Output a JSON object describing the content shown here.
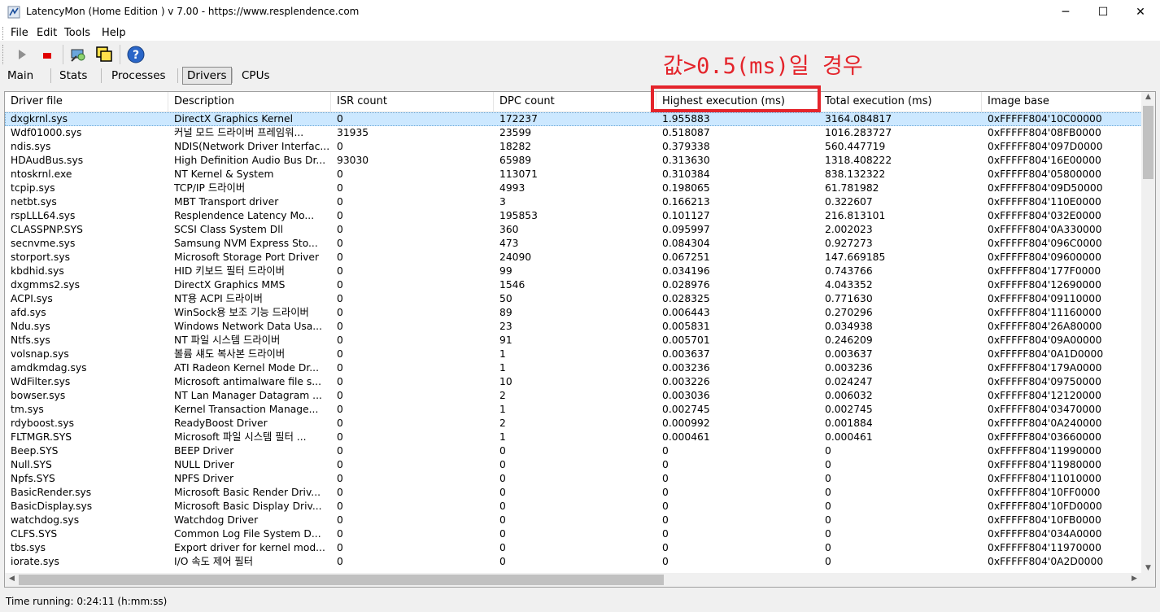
{
  "window": {
    "title": "LatencyMon  (Home Edition )  v 7.00 - https://www.resplendence.com",
    "minimize_glyph": "─",
    "maximize_glyph": "☐",
    "close_glyph": "✕"
  },
  "menu": {
    "file": "File",
    "edit": "Edit",
    "tools": "Tools",
    "help": "Help"
  },
  "toolbar": {
    "icons": [
      "play-icon",
      "stop-icon",
      "analyze-icon",
      "windows-icon",
      "help-icon"
    ]
  },
  "tabs": [
    {
      "label": "Main",
      "active": false
    },
    {
      "label": "Stats",
      "active": false
    },
    {
      "label": "Processes",
      "active": false
    },
    {
      "label": "Drivers",
      "active": true
    },
    {
      "label": "CPUs",
      "active": false
    }
  ],
  "annotation": "값>0.5(ms)일 경우",
  "colors": {
    "annotation": "#e4242b",
    "selection": "#cce8ff"
  },
  "table": {
    "columns": [
      "Driver file",
      "Description",
      "ISR count",
      "DPC count",
      "Highest execution (ms)",
      "Total execution (ms)",
      "Image base"
    ],
    "rows": [
      [
        "dxgkrnl.sys",
        "DirectX Graphics Kernel",
        "0",
        "172237",
        "1.955883",
        "3164.084817",
        "0xFFFFF804'10C00000"
      ],
      [
        "Wdf01000.sys",
        "커널 모드 드라이버 프레임워...",
        "31935",
        "23599",
        "0.518087",
        "1016.283727",
        "0xFFFFF804'08FB0000"
      ],
      [
        "ndis.sys",
        "NDIS(Network Driver Interfac...",
        "0",
        "18282",
        "0.379338",
        "560.447719",
        "0xFFFFF804'097D0000"
      ],
      [
        "HDAudBus.sys",
        "High Definition Audio Bus Dr...",
        "93030",
        "65989",
        "0.313630",
        "1318.408222",
        "0xFFFFF804'16E00000"
      ],
      [
        "ntoskrnl.exe",
        "NT Kernel & System",
        "0",
        "113071",
        "0.310384",
        "838.132322",
        "0xFFFFF804'05800000"
      ],
      [
        "tcpip.sys",
        "TCP/IP 드라이버",
        "0",
        "4993",
        "0.198065",
        "61.781982",
        "0xFFFFF804'09D50000"
      ],
      [
        "netbt.sys",
        "MBT Transport driver",
        "0",
        "3",
        "0.166213",
        "0.322607",
        "0xFFFFF804'110E0000"
      ],
      [
        "rspLLL64.sys",
        "Resplendence Latency Mo...",
        "0",
        "195853",
        "0.101127",
        "216.813101",
        "0xFFFFF804'032E0000"
      ],
      [
        "CLASSPNP.SYS",
        "SCSI Class System Dll",
        "0",
        "360",
        "0.095997",
        "2.002023",
        "0xFFFFF804'0A330000"
      ],
      [
        "secnvme.sys",
        "Samsung NVM Express Sto...",
        "0",
        "473",
        "0.084304",
        "0.927273",
        "0xFFFFF804'096C0000"
      ],
      [
        "storport.sys",
        "Microsoft Storage Port Driver",
        "0",
        "24090",
        "0.067251",
        "147.669185",
        "0xFFFFF804'09600000"
      ],
      [
        "kbdhid.sys",
        "HID 키보드 필터 드라이버",
        "0",
        "99",
        "0.034196",
        "0.743766",
        "0xFFFFF804'177F0000"
      ],
      [
        "dxgmms2.sys",
        "DirectX Graphics MMS",
        "0",
        "1546",
        "0.028976",
        "4.043352",
        "0xFFFFF804'12690000"
      ],
      [
        "ACPI.sys",
        "NT용 ACPI 드라이버",
        "0",
        "50",
        "0.028325",
        "0.771630",
        "0xFFFFF804'09110000"
      ],
      [
        "afd.sys",
        "WinSock용 보조 기능 드라이버",
        "0",
        "89",
        "0.006443",
        "0.270296",
        "0xFFFFF804'11160000"
      ],
      [
        "Ndu.sys",
        "Windows Network Data Usa...",
        "0",
        "23",
        "0.005831",
        "0.034938",
        "0xFFFFF804'26A80000"
      ],
      [
        "Ntfs.sys",
        "NT 파일 시스템 드라이버",
        "0",
        "91",
        "0.005701",
        "0.246209",
        "0xFFFFF804'09A00000"
      ],
      [
        "volsnap.sys",
        "볼륨 섀도 복사본 드라이버",
        "0",
        "1",
        "0.003637",
        "0.003637",
        "0xFFFFF804'0A1D0000"
      ],
      [
        "amdkmdag.sys",
        "ATI Radeon Kernel Mode Dr...",
        "0",
        "1",
        "0.003236",
        "0.003236",
        "0xFFFFF804'179A0000"
      ],
      [
        "WdFilter.sys",
        "Microsoft antimalware file s...",
        "0",
        "10",
        "0.003226",
        "0.024247",
        "0xFFFFF804'09750000"
      ],
      [
        "bowser.sys",
        "NT Lan Manager Datagram ...",
        "0",
        "2",
        "0.003036",
        "0.006032",
        "0xFFFFF804'12120000"
      ],
      [
        "tm.sys",
        "Kernel Transaction Manage...",
        "0",
        "1",
        "0.002745",
        "0.002745",
        "0xFFFFF804'03470000"
      ],
      [
        "rdyboost.sys",
        "ReadyBoost Driver",
        "0",
        "2",
        "0.000992",
        "0.001884",
        "0xFFFFF804'0A240000"
      ],
      [
        "FLTMGR.SYS",
        "Microsoft 파일 시스템 필터 ...",
        "0",
        "1",
        "0.000461",
        "0.000461",
        "0xFFFFF804'03660000"
      ],
      [
        "Beep.SYS",
        "BEEP Driver",
        "0",
        "0",
        "0",
        "0",
        "0xFFFFF804'11990000"
      ],
      [
        "Null.SYS",
        "NULL Driver",
        "0",
        "0",
        "0",
        "0",
        "0xFFFFF804'11980000"
      ],
      [
        "Npfs.SYS",
        "NPFS Driver",
        "0",
        "0",
        "0",
        "0",
        "0xFFFFF804'11010000"
      ],
      [
        "BasicRender.sys",
        "Microsoft Basic Render Driv...",
        "0",
        "0",
        "0",
        "0",
        "0xFFFFF804'10FF0000"
      ],
      [
        "BasicDisplay.sys",
        "Microsoft Basic Display Driv...",
        "0",
        "0",
        "0",
        "0",
        "0xFFFFF804'10FD0000"
      ],
      [
        "watchdog.sys",
        "Watchdog Driver",
        "0",
        "0",
        "0",
        "0",
        "0xFFFFF804'10FB0000"
      ],
      [
        "CLFS.SYS",
        "Common Log File System D...",
        "0",
        "0",
        "0",
        "0",
        "0xFFFFF804'034A0000"
      ],
      [
        "tbs.sys",
        "Export driver for kernel mod...",
        "0",
        "0",
        "0",
        "0",
        "0xFFFFF804'11970000"
      ],
      [
        "iorate.sys",
        "I/O 속도 제어 필터",
        "0",
        "0",
        "0",
        "0",
        "0xFFFFF804'0A2D0000"
      ]
    ]
  },
  "status": {
    "time_running": "Time running: 0:24:11   (h:mm:ss)"
  }
}
